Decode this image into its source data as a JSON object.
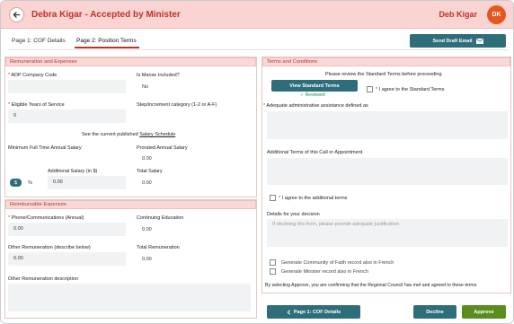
{
  "header": {
    "title": "Debra Kigar - Accepted by Minister",
    "user_name": "Deb Kigar",
    "avatar_initials": "DK",
    "accent_color": "#c0312b",
    "avatar_color": "#e5571c"
  },
  "tabs": [
    {
      "label": "Page 1: COF Details",
      "active": false
    },
    {
      "label": "Page 2: Position Terms",
      "active": true
    }
  ],
  "toolbar": {
    "send_draft_label": "Send Draft Email",
    "send_draft_icon": "envelope-icon"
  },
  "remuneration": {
    "heading": "Remuneration and Expenses",
    "adp_label": "ADP Company Code",
    "adp_value": "",
    "manse_label": "Is Manse Included?",
    "manse_value": "No",
    "eligible_label": "Eligible Years of Service",
    "eligible_value": "0",
    "step_label": "Step/increment category (1-2 or A-F)",
    "step_value": "",
    "schedule_text": "See the current published",
    "schedule_link": "Salary Schedule",
    "min_salary_label": "Minimum Full Time Annual Salary",
    "min_salary_value": "",
    "prorated_label": "Prorated Annual Salary",
    "prorated_value": "0.00",
    "additional_label": "Additional Salary (in $)",
    "additional_value": "0.00",
    "total_label": "Total Salary",
    "total_value": "0.00",
    "toggle_dollar": "$",
    "toggle_percent": "%"
  },
  "reimbursable": {
    "heading": "Reimbursable Expenses",
    "phone_label": "Phone/Communications (Annual)",
    "phone_value": "0.00",
    "ce_label": "Continuing Education",
    "ce_value": "0.00",
    "other_label": "Other Remuneration (describe below)",
    "other_value": "0.00",
    "total_rem_label": "Total Remuneration",
    "total_rem_value": "0.00",
    "other_desc_label": "Other Remuneration description",
    "other_desc_value": ""
  },
  "terms": {
    "heading": "Terms and Conditions",
    "review_text": "Please review the Standard Terms before proceeding",
    "view_button": "View Standard Terms",
    "reviewed_text": "✓ Reviewed",
    "agree_standard": "I agree to the Standard Terms",
    "admin_label": "Adequate administrative assistance defined as",
    "admin_value": "",
    "additional_label": "Additional Terms of this Call or Appointment",
    "additional_value": "",
    "agree_additional": "I agree to the additional terms",
    "details_label": "Details for your decision",
    "details_placeholder": "If declining this form, please provide adequate justification",
    "gen_cof_french": "Generate Community of Faith record also in French",
    "gen_minister_french": "Generate Minister record also in French",
    "approve_note": "By selecting Approve, you are confirming that the Regional Council has met and agreed to these terms"
  },
  "footer": {
    "back_button": "Page 1: COF Details",
    "decline_button": "Decline",
    "approve_button": "Approve"
  }
}
